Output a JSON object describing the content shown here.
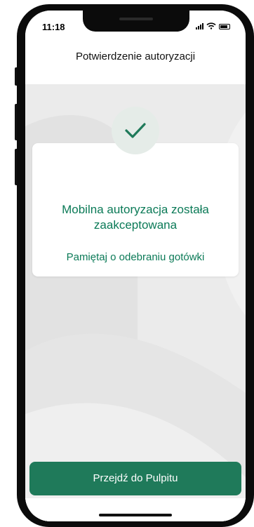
{
  "status_bar": {
    "time": "11:18"
  },
  "header": {
    "title": "Potwierdzenie autoryzacji"
  },
  "confirmation": {
    "icon": "check-icon",
    "title_line1": "Mobilna autoryzacja została",
    "title_line2": "zaakceptowana",
    "subtitle": "Pamiętaj o odebraniu gotówki"
  },
  "actions": {
    "primary_label": "Przejdź do Pulpitu"
  },
  "colors": {
    "brand_green": "#1f7a5a",
    "text_green": "#0b7a57",
    "check_bg": "#e5ece8",
    "screen_bg": "#e9e9e9"
  }
}
